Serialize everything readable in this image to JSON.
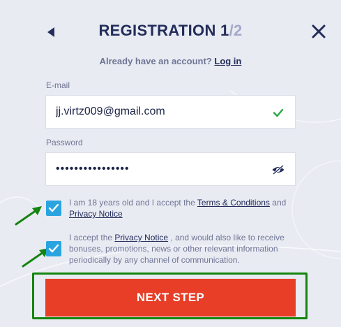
{
  "header": {
    "title": "REGISTRATION 1",
    "title_total": "/2"
  },
  "login": {
    "prompt": "Already have an account?",
    "link": "Log in"
  },
  "email": {
    "label": "E-mail",
    "value": "jj.virtz009@gmail.com",
    "status_icon": "check-icon"
  },
  "password": {
    "label": "Password",
    "masked_value": "••••••••••••••••",
    "toggle_icon": "eye-slash-icon"
  },
  "consents": [
    {
      "checked": true,
      "text_before": "I am 18 years old and I accept the ",
      "link1": "Terms & Conditions",
      "text_middle": " and ",
      "link2": "Privacy Notice"
    },
    {
      "checked": true,
      "text_before": "I accept the ",
      "link": "Privacy Notice",
      "text_after": " , and would also like to receive bonuses, promotions, news or other relevant information periodically by any channel of communication."
    }
  ],
  "next_button": {
    "label": "NEXT STEP"
  },
  "colors": {
    "background": "#e9ebf3",
    "title": "#232d5a",
    "checkbox": "#2aa4df",
    "primary_button": "#e83d26",
    "highlight": "#14850f",
    "success": "#28a745"
  }
}
